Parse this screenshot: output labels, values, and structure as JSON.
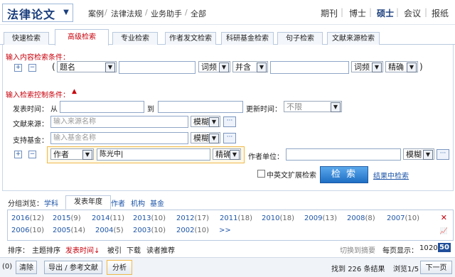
{
  "header": {
    "logo": "法律论文",
    "crumbs": [
      "案例",
      "法律法规",
      "业务助手",
      "全部"
    ],
    "nav": [
      "期刊",
      "博士",
      "硕士",
      "会议",
      "报纸"
    ],
    "nav_active": "硕士"
  },
  "tabs": [
    "快速检索",
    "高级检索",
    "专业检索",
    "作者发文检索",
    "科研基金检索",
    "句子检索",
    "文献来源检索"
  ],
  "content_section": {
    "title": "输入内容检索条件：",
    "row": {
      "open_paren": "(",
      "field1": "题名",
      "freq1": "词频",
      "logic": "并含",
      "freq2": "词频",
      "match": "精确",
      "close_paren": ")"
    }
  },
  "control_section": {
    "title": "输入检索控制条件：",
    "publish_time_label": "发表时间：",
    "from_label": "从",
    "to_label": "到",
    "update_time_label": "更新时间：",
    "update_time_value": "不限",
    "source_label": "文献来源：",
    "source_placeholder": "输入来源名称",
    "source_match": "模糊",
    "fund_label": "支持基金：",
    "fund_placeholder": "输入基金名称",
    "fund_match": "模糊",
    "author_field": "作者",
    "author_value": "陈光中",
    "author_match": "精确",
    "unit_label": "作者单位：",
    "unit_match": "模糊",
    "ext_label": "中英文扩展检索",
    "search_button": "检 索",
    "search_in_results": "结果中检索"
  },
  "group_browse": {
    "label": "分组浏览：",
    "tabs": [
      "学科",
      "发表年度",
      "作者",
      "机构",
      "基金"
    ],
    "active_tab": "发表年度",
    "years_row1": [
      {
        "year": "2016",
        "count": "(12)"
      },
      {
        "year": "2015",
        "count": "(9)"
      },
      {
        "year": "2014",
        "count": "(11)"
      },
      {
        "year": "2013",
        "count": "(10)"
      },
      {
        "year": "2012",
        "count": "(17)"
      },
      {
        "year": "2011",
        "count": "(18)"
      },
      {
        "year": "2010",
        "count": "(18)"
      },
      {
        "year": "2009",
        "count": "(13)"
      },
      {
        "year": "2008",
        "count": "(8)"
      },
      {
        "year": "2007",
        "count": "(10)"
      }
    ],
    "years_row2": [
      {
        "year": "2006",
        "count": "(10)"
      },
      {
        "year": "2005",
        "count": "(14)"
      },
      {
        "year": "2004",
        "count": "(5)"
      },
      {
        "year": "2003",
        "count": "(10)"
      },
      {
        "year": "2002",
        "count": "(10)"
      }
    ],
    "more": ">>"
  },
  "sort": {
    "label": "排序：",
    "items": [
      "主题排序",
      "发表时间",
      "被引",
      "下载",
      "读者推荐"
    ],
    "active": "发表时间",
    "arrow": "↓",
    "switch_abstract": "切换到摘要",
    "per_page_label": "每页显示：",
    "per_page_options": [
      "10",
      "20",
      "50"
    ],
    "per_page_active": "50"
  },
  "bottom": {
    "selected_count": "0",
    "clear": "清除",
    "export": "导出 / 参考文献",
    "analyze": "分析",
    "results_prefix": "找到",
    "results_count": "226",
    "results_suffix": "条结果",
    "page_label": "浏览1/5",
    "next": "下一页"
  },
  "colors": {
    "brand": "#1b3f7e",
    "accent_red": "#c7000b",
    "link_blue": "#1d55a8",
    "search_button": "#2b7fd4"
  }
}
